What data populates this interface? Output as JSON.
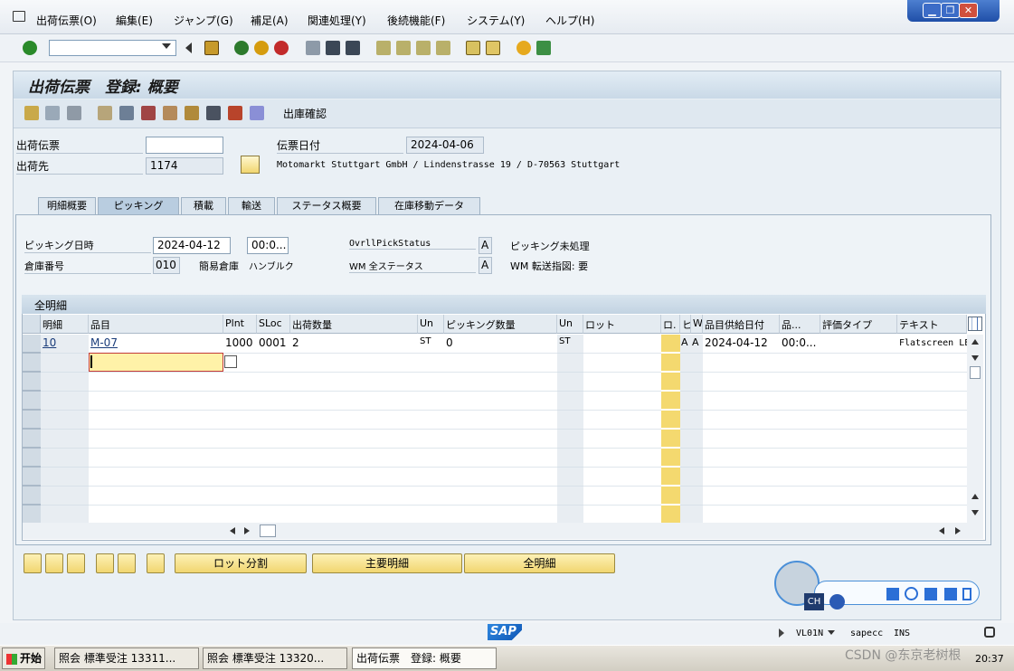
{
  "menu": {
    "items": [
      "出荷伝票(O)",
      "編集(E)",
      "ジャンプ(G)",
      "補足(A)",
      "関連処理(Y)",
      "後続機能(F)",
      "システム(Y)",
      "ヘルプ(H)"
    ]
  },
  "window_controls": {
    "minimize": "▁",
    "restore": "❐",
    "close": "✕"
  },
  "command": {
    "value": ""
  },
  "screen": {
    "title": "出荷伝票　登録: 概要",
    "app_button_label": "出庫確認"
  },
  "header": {
    "delivery_label": "出荷伝票",
    "delivery_value": "",
    "shipto_label": "出荷先",
    "shipto_value": "1174",
    "doc_date_label": "伝票日付",
    "doc_date_value": "2024-04-06",
    "address": "Motomarkt Stuttgart GmbH / Lindenstrasse 19 / D-70563 Stuttgart"
  },
  "tabs": [
    "明細概要",
    "ピッキング",
    "積載",
    "輸送",
    "ステータス概要",
    "在庫移動データ"
  ],
  "active_tab": 1,
  "picking": {
    "date_label": "ピッキング日時",
    "date_value": "2024-04-12",
    "time_value": "00:0...",
    "overall_label": "OvrllPickStatus",
    "overall_value": "A",
    "overall_text": "ピッキング未処理",
    "warehouse_label": "倉庫番号",
    "warehouse_value": "010",
    "warehouse_type_label": "簡易倉庫",
    "warehouse_type_value": "ハンブルク",
    "wm_label": "WM 全ステータス",
    "wm_value": "A",
    "wm_text": "WM 転送指図: 要"
  },
  "table": {
    "title": "全明細",
    "columns": [
      "明細",
      "品目",
      "Plnt",
      "SLoc",
      "出荷数量",
      "Un",
      "ピッキング数量",
      "Un",
      "ロット",
      "ロ.",
      "ヒ",
      "W.",
      "品目供給日付",
      "品...",
      "評価タイプ",
      "テキスト"
    ],
    "rows": [
      [
        "10",
        "M-07",
        "1000",
        "0001",
        "2",
        "ST",
        "0",
        "ST",
        "",
        "",
        "A",
        "A",
        "2024-04-12",
        "00:0...",
        "",
        "Flatscreen LE"
      ]
    ]
  },
  "buttons": {
    "batch_split": "ロット分割",
    "main_items": "主要明細",
    "all_items": "全明細"
  },
  "status": {
    "tcode": "VL01N",
    "system": "sapecc",
    "mode": "INS",
    "sap_logo": "SAP"
  },
  "ime": {
    "lang": "CH"
  },
  "taskbar": {
    "start": "开始",
    "tasks": [
      "照会 標準受注 13311...",
      "照会 標準受注 13320...",
      "出荷伝票　登録: 概要"
    ],
    "clock": "20:37"
  },
  "watermark": "CSDN @东京老树根",
  "colors": {
    "accent": "#f1d670",
    "title_bg": "#c9d9e7",
    "input_yellow": "#fff2a8"
  }
}
